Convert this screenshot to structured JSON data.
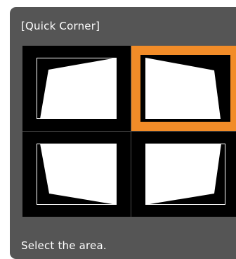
{
  "dialog": {
    "title": "[Quick Corner]",
    "status": "Select the area."
  },
  "grid": {
    "selected_index": 1,
    "cells": [
      {
        "name": "top-left"
      },
      {
        "name": "top-right"
      },
      {
        "name": "bottom-left"
      },
      {
        "name": "bottom-right"
      }
    ]
  },
  "colors": {
    "panel": "#555555",
    "grid": "#000000",
    "selection": "#f28c28",
    "frame": "#ffffff",
    "shape": "#ffffff"
  }
}
